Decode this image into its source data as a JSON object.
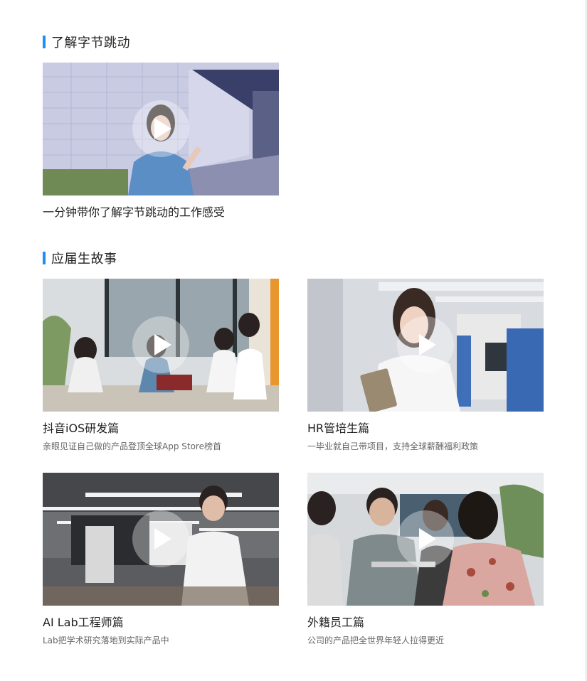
{
  "sections": [
    {
      "title": "了解字节跳动",
      "cards": [
        {
          "title": "一分钟带你了解字节跳动的工作感受",
          "desc": ""
        }
      ]
    },
    {
      "title": "应届生故事",
      "cards": [
        {
          "title": "抖音iOS研发篇",
          "desc": "亲眼见证自己做的产品登顶全球App Store榜首"
        },
        {
          "title": "HR管培生篇",
          "desc": "一毕业就自己带项目，支持全球薪酬福利政策"
        },
        {
          "title": "AI Lab工程师篇",
          "desc": "Lab把学术研究落地到实际产品中"
        },
        {
          "title": "外籍员工篇",
          "desc": "公司的产品把全世界年轻人拉得更近"
        }
      ]
    }
  ],
  "icons": {
    "play": "play-icon"
  },
  "colors": {
    "accent": "#1f8cf7",
    "title": "#222222",
    "desc": "#666666"
  }
}
